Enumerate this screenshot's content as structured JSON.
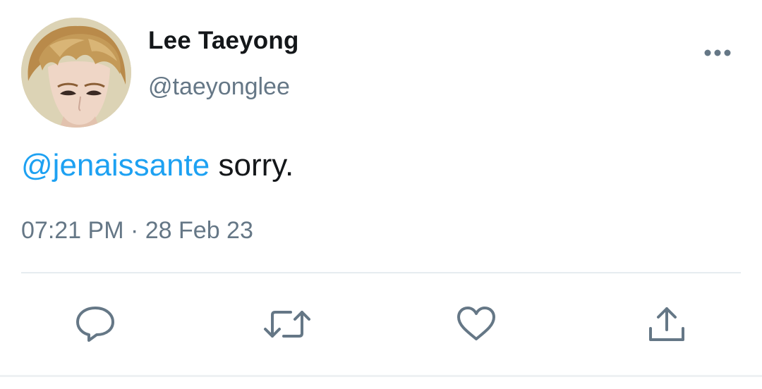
{
  "tweet": {
    "author": {
      "display_name": "Lee Taeyong",
      "handle": "@taeyonglee",
      "avatar": "profile-photo"
    },
    "text": {
      "mention": "@jenaissante",
      "content": " sorry."
    },
    "timestamp": {
      "time": "07:21 PM",
      "separator": " · ",
      "date": "28 Feb 23"
    },
    "actions": [
      "reply-icon",
      "retweet-icon",
      "like-icon",
      "share-icon"
    ],
    "more_icon": "more-horizontal-icon"
  },
  "colors": {
    "text": "#14171a",
    "secondary": "#657786",
    "link": "#1da1f2",
    "divider": "#e6ecf0"
  }
}
